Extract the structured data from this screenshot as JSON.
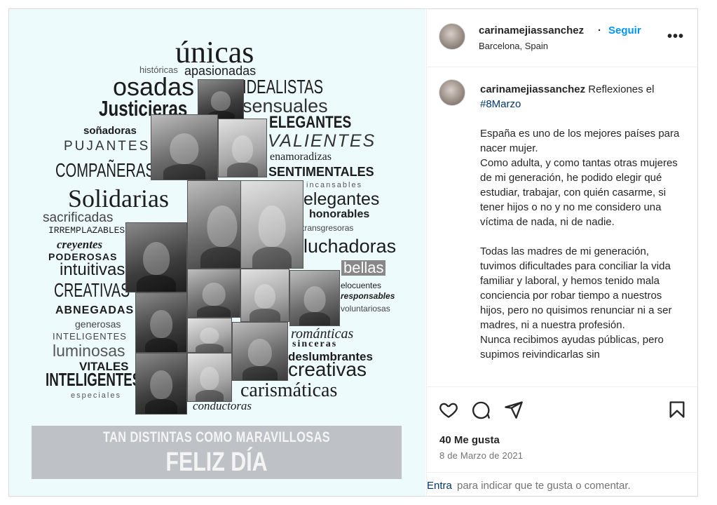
{
  "post": {
    "username": "carinamejiassanchez",
    "separator": "·",
    "follow_label": "Seguir",
    "location": "Barcelona, Spain",
    "more_label": "•••"
  },
  "caption": {
    "username": "carinamejiassanchez",
    "intro": "Reflexiones el",
    "hashtag": "#8Marzo",
    "paragraph1": "España es uno de los mejores países para nacer mujer.\nComo adulta, y como tantas otras mujeres de mi generación, he podido elegir qué estudiar, trabajar, con quién casarme, si tener hijos o no y no me considero una víctima de nada, ni de nadie.",
    "paragraph2": "Todas las madres de mi generación, tuvimos dificultades para conciliar la vida familiar y laboral, y hemos tenido mala conciencia por robar tiempo a nuestros hijos, pero no quisimos renunciar ni a ser madres, ni a nuestra profesión.\nNunca recibimos ayudas públicas, pero supimos reivindicarlas sin"
  },
  "actions": {
    "like_icon": "heart-icon",
    "comment_icon": "comment-icon",
    "share_icon": "send-icon",
    "save_icon": "bookmark-icon",
    "likes": "40 Me gusta",
    "date": "8 de Marzo de 2021"
  },
  "comment_bar": {
    "link": "Entra",
    "text": "para indicar que te gusta o comentar."
  },
  "image": {
    "words": [
      "únicas",
      "históricas",
      "apasionadas",
      "osadas",
      "IDEALISTAS",
      "Justicieras",
      "sensuales",
      "soñadoras",
      "ELEGANTES",
      "PUJANTES",
      "VALIENTES",
      "enamoradizas",
      "COMPAÑERAS",
      "SENTIMENTALES",
      "incansables",
      "Solidarias",
      "elegantes",
      "sacrificadas",
      "honorables",
      "IRREMPLAZABLES",
      "transgresoras",
      "creyentes",
      "luchadoras",
      "PODEROSAS",
      "intuitivas",
      "bellas",
      "CREATIVAS",
      "elocuentes",
      "responsables",
      "voluntariosas",
      "ABNEGADAS",
      "generosas",
      "románticas",
      "INTELIGENTES",
      "sinceras",
      "luminosas",
      "deslumbrantes",
      "VITALES",
      "creativas",
      "INTELIGENTES",
      "especiales",
      "carismáticas",
      "conductoras"
    ],
    "banner_line1": "TAN DISTINTAS COMO MARAVILLOSAS",
    "banner_line2": "FELIZ DÍA"
  }
}
